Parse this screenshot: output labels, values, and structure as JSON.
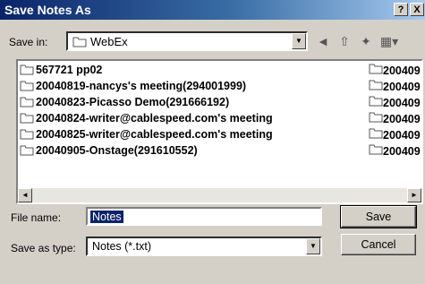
{
  "window": {
    "title": "Save Notes As",
    "help_label": "?",
    "close_label": "X"
  },
  "save_in": {
    "label": "Save in:",
    "value": "WebEx"
  },
  "files": [
    {
      "name": "567721 pp02",
      "name2": "200409"
    },
    {
      "name": "20040819-nancys's meeting(294001999)",
      "name2": "200409"
    },
    {
      "name": "20040823-Picasso Demo(291666192)",
      "name2": "200409"
    },
    {
      "name": "20040824-writer@cablespeed.com's meeting",
      "name2": "200409"
    },
    {
      "name": "20040825-writer@cablespeed.com's meeting",
      "name2": "200409"
    },
    {
      "name": "20040905-Onstage(291610552)",
      "name2": "200409"
    }
  ],
  "file_name": {
    "label": "File name:",
    "value": "Notes"
  },
  "save_as_type": {
    "label": "Save as type:",
    "value": "Notes (*.txt)"
  },
  "buttons": {
    "save": "Save",
    "cancel": "Cancel"
  },
  "icons": {
    "back": "back-arrow-icon",
    "up": "up-folder-icon",
    "new_folder": "new-folder-icon",
    "views": "views-menu-icon"
  }
}
